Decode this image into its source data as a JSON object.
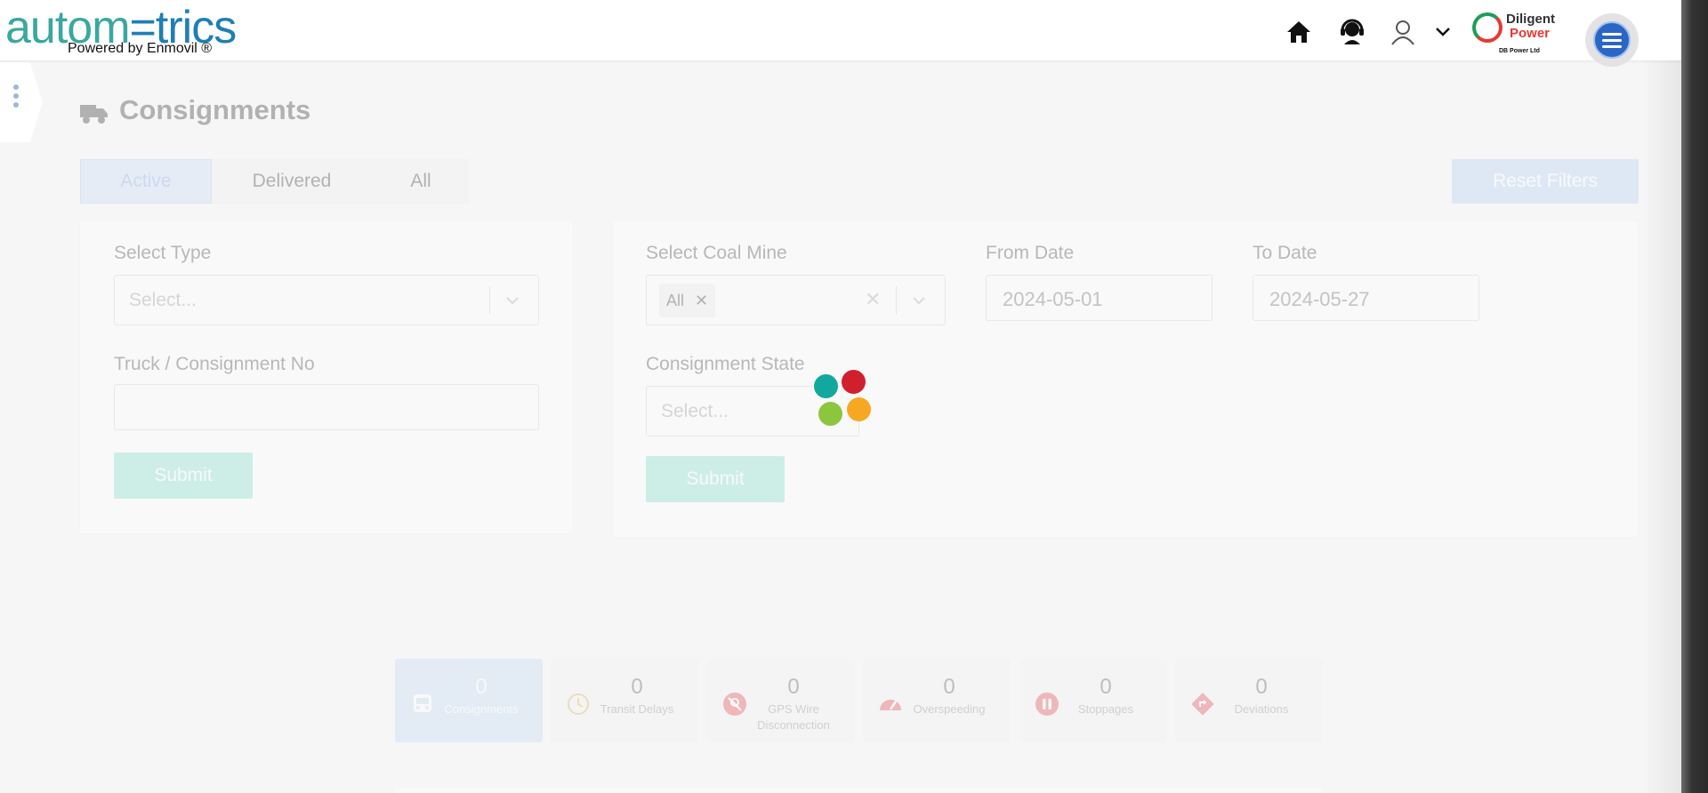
{
  "header": {
    "logo_part1": "autom",
    "logo_part2": "=trics",
    "logo_sub": "Powered by Enmovil ®",
    "icons": [
      "home-icon",
      "support-icon",
      "user-icon",
      "chevron-down-icon"
    ],
    "brand": {
      "line1": "Diligent",
      "line2": "Power",
      "line3": "DB Power Ltd"
    }
  },
  "page": {
    "title": "Consignments"
  },
  "tabs": [
    {
      "label": "Active"
    },
    {
      "label": "Delivered"
    },
    {
      "label": "All"
    }
  ],
  "reset_filters_label": "Reset Filters",
  "filters_left": {
    "select_type_label": "Select Type",
    "select_type_placeholder": "Select...",
    "truck_label": "Truck / Consignment No",
    "truck_value": "",
    "submit_label": "Submit"
  },
  "filters_right": {
    "coal_mine_label": "Select Coal Mine",
    "coal_mine_selected": "All",
    "from_date_label": "From Date",
    "from_date_value": "2024-05-01",
    "to_date_label": "To Date",
    "to_date_value": "2024-05-27",
    "state_label": "Consignment State",
    "state_placeholder": "Select...",
    "submit_label": "Submit"
  },
  "stats": [
    {
      "value": "0",
      "label": "Consignments",
      "icon": "truck-icon"
    },
    {
      "value": "0",
      "label": "Transit Delays",
      "icon": "clock-icon"
    },
    {
      "value": "0",
      "label": "GPS Wire Disconnection",
      "icon": "gps-off-icon"
    },
    {
      "value": "0",
      "label": "Overspeeding",
      "icon": "speedometer-icon"
    },
    {
      "value": "0",
      "label": "Stoppages",
      "icon": "pause-icon"
    },
    {
      "value": "0",
      "label": "Deviations",
      "icon": "route-deviation-icon"
    }
  ],
  "colors": {
    "accent_blue": "#2b66c5",
    "tab_active": "#c9dcf6",
    "submit_green": "#7fe0c9",
    "loader": [
      "#13a89e",
      "#d0202e",
      "#8cc63f",
      "#f7a823"
    ]
  }
}
